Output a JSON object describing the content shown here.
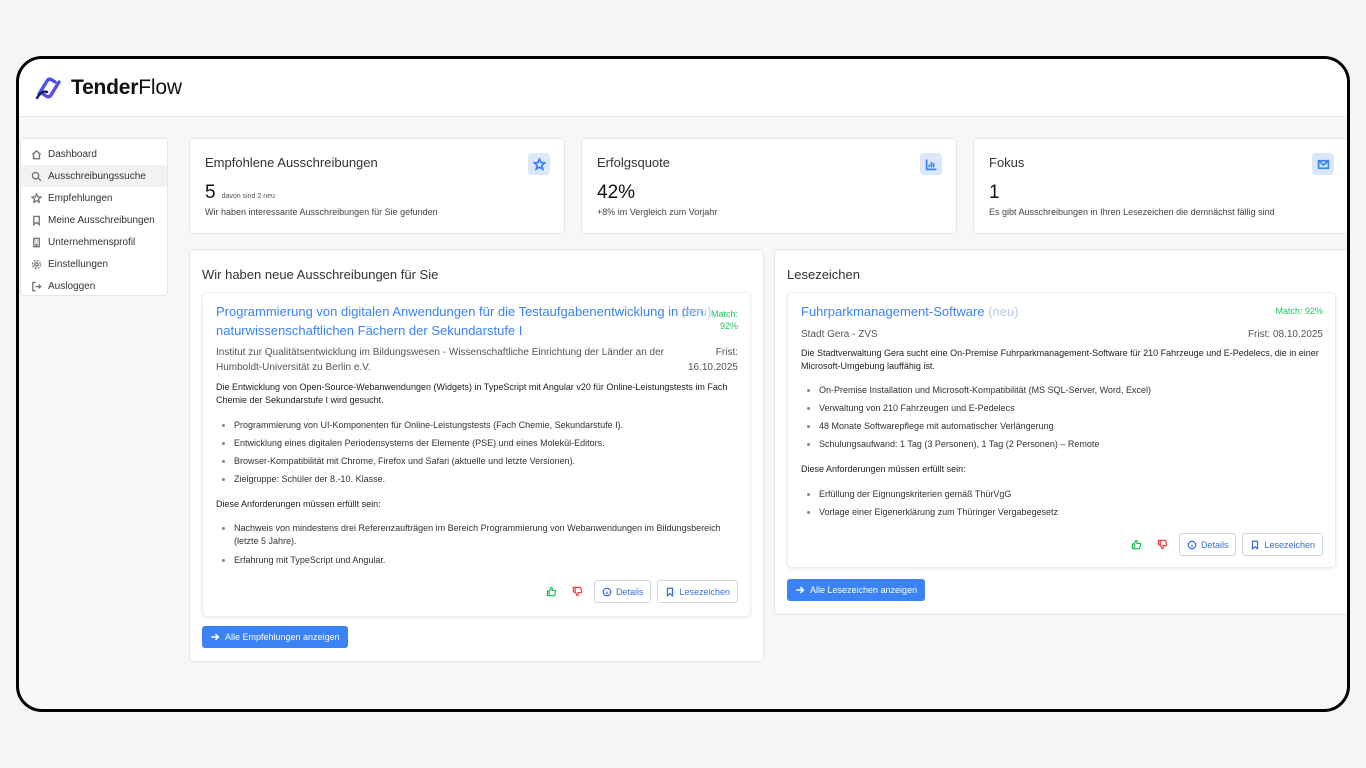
{
  "app": {
    "name_bold": "Tender",
    "name_rest": "Flow"
  },
  "sidebar": {
    "items": [
      {
        "label": "Dashboard",
        "icon": "home-icon"
      },
      {
        "label": "Ausschreibungssuche",
        "icon": "search-icon"
      },
      {
        "label": "Empfehlungen",
        "icon": "star-icon"
      },
      {
        "label": "Meine Ausschreibungen",
        "icon": "bookmark-icon"
      },
      {
        "label": "Unternehmensprofil",
        "icon": "building-icon"
      },
      {
        "label": "Einstellungen",
        "icon": "gear-icon"
      },
      {
        "label": "Ausloggen",
        "icon": "logout-icon"
      }
    ],
    "active": "Ausschreibungssuche"
  },
  "stats": [
    {
      "title": "Empfohlene Ausschreibungen",
      "value": "5",
      "sub": "davon sind 2 neu",
      "desc": "Wir haben interessante Ausschreibungen für Sie gefunden",
      "icon": "star-icon"
    },
    {
      "title": "Erfolgsquote",
      "value": "42%",
      "sub": "",
      "desc": "+8% im Vergleich zum Vorjahr",
      "icon": "chart-icon"
    },
    {
      "title": "Fokus",
      "value": "1",
      "sub": "",
      "desc": "Es gibt Ausschreibungen in Ihren Lesezeichen die demnächst fällig sind",
      "icon": "mail-icon"
    }
  ],
  "recommendations": {
    "title": "Wir haben neue Ausschreibungen für Sie",
    "card": {
      "title": "Programmierung von digitalen Anwendungen für die Testaufgabenentwicklung in den naturwissenschaftlichen Fächern der Sekundarstufe I",
      "new_tag": "(neu)",
      "match_label": "Match:",
      "match_value": "92%",
      "org": "Institut zur Qualitätsentwicklung im Bildungswesen - Wissenschaftliche Einrichtung der Länder an der Humboldt-Universität zu Berlin e.V.",
      "frist_label": "Frist:",
      "frist_date": "16.10.2025",
      "description": "Die Entwicklung von Open-Source-Webanwendungen (Widgets) in TypeScript mit Angular v20 für Online-Leistungstests im Fach Chemie der Sekundarstufe I wird gesucht.",
      "bullets": [
        "Programmierung von UI-Komponenten für Online-Leistungstests (Fach Chemie, Sekundarstufe I).",
        "Entwicklung eines digitalen Periodensystems der Elemente (PSE) und eines Molekül-Editors.",
        "Browser-Kompatibilität mit Chrome, Firefox und Safari (aktuelle und letzte Versionen).",
        "Zielgruppe: Schüler der 8.-10. Klasse."
      ],
      "requirements_heading": "Diese Anforderungen müssen erfüllt sein:",
      "requirements": [
        "Nachweis von mindestens drei Referenzaufträgen im Bereich Programmierung von Webanwendungen im Bildungsbereich (letzte 5 Jahre).",
        "Erfahrung mit TypeScript und Angular."
      ],
      "details_label": "Details",
      "bookmark_label": "Lesezeichen"
    },
    "all_button": "Alle Empfehlungen anzeigen"
  },
  "bookmarks": {
    "title": "Lesezeichen",
    "card": {
      "title": "Fuhrparkmanagement-Software",
      "new_tag": "(neu)",
      "match": "Match: 92%",
      "org": "Stadt Gera - ZVS",
      "frist": "Frist: 08.10.2025",
      "description": "Die Stadtverwaltung Gera sucht eine On-Premise Fuhrparkmanagement-Software für 210 Fahrzeuge und E-Pedelecs, die in einer Microsoft-Umgebung lauffähig ist.",
      "bullets": [
        "On-Premise Installation und Microsoft-Kompatibilität (MS SQL-Server, Word, Excel)",
        "Verwaltung von 210 Fahrzeugen und E-Pedelecs",
        "48 Monate Softwarepflege mit automatischer Verlängerung",
        "Schulungsaufwand: 1 Tag (3 Personen), 1 Tag (2 Personen) – Remote"
      ],
      "requirements_heading": "Diese Anforderungen müssen erfüllt sein:",
      "requirements": [
        "Erfüllung der Eignungskriterien gemäß ThürVgG",
        "Vorlage einer Eigenerklärung zum Thüringer Vergabegesetz"
      ],
      "details_label": "Details",
      "bookmark_label": "Lesezeichen"
    },
    "all_button": "Alle Lesezeichen anzeigen"
  },
  "colors": {
    "accent": "#3b82f6",
    "match": "#22c55e",
    "dislike": "#ef4444"
  }
}
